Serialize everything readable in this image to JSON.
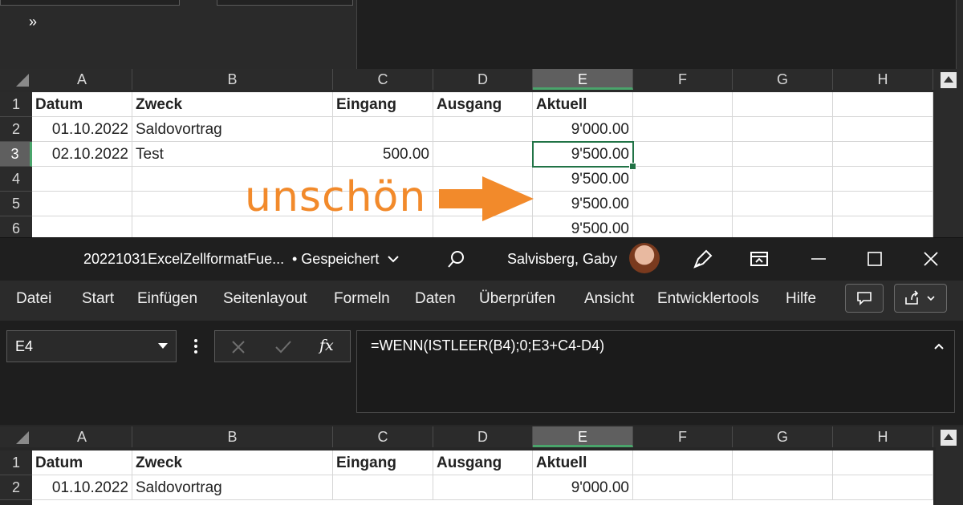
{
  "annotation": {
    "text": "unschön",
    "color": "#f28a2b"
  },
  "columns": [
    "A",
    "B",
    "C",
    "D",
    "E",
    "F",
    "G",
    "H"
  ],
  "top_sheet": {
    "rows": [
      {
        "num": "1",
        "cells": [
          "Datum",
          "Zweck",
          "Eingang",
          "Ausgang",
          "Aktuell",
          "",
          "",
          ""
        ]
      },
      {
        "num": "2",
        "cells": [
          "01.10.2022",
          "Saldovortrag",
          "",
          "",
          "9'000.00",
          "",
          "",
          ""
        ]
      },
      {
        "num": "3",
        "cells": [
          "02.10.2022",
          "Test",
          "500.00",
          "",
          "9'500.00",
          "",
          "",
          ""
        ]
      },
      {
        "num": "4",
        "cells": [
          "",
          "",
          "",
          "",
          "9'500.00",
          "",
          "",
          ""
        ]
      },
      {
        "num": "5",
        "cells": [
          "",
          "",
          "",
          "",
          "9'500.00",
          "",
          "",
          ""
        ]
      },
      {
        "num": "6",
        "cells": [
          "",
          "",
          "",
          "",
          "9'500.00",
          "",
          "",
          ""
        ]
      }
    ],
    "selected_row": "3",
    "selected_col": "E"
  },
  "titlebar": {
    "overflow_icon": "»",
    "filename": "20221031ExcelZellformatFue...",
    "status": "• Gespeichert",
    "user": "Salvisberg, Gaby",
    "icons": [
      "chevron-down-icon",
      "search-icon",
      "avatar",
      "pen-icon",
      "ribbon-display-icon",
      "minimize-icon",
      "maximize-icon",
      "close-icon"
    ]
  },
  "menu": [
    "Datei",
    "Start",
    "Einfügen",
    "Seitenlayout",
    "Formeln",
    "Daten",
    "Überprüfen",
    "Ansicht",
    "Entwicklertools",
    "Hilfe"
  ],
  "formula_bar": {
    "name_box": "E4",
    "fx_label": "fx",
    "formula": "=WENN(ISTLEER(B4);0;E3+C4-D4)"
  },
  "bottom_sheet": {
    "rows": [
      {
        "num": "1",
        "cells": [
          "Datum",
          "Zweck",
          "Eingang",
          "Ausgang",
          "Aktuell",
          "",
          "",
          ""
        ]
      },
      {
        "num": "2",
        "cells": [
          "01.10.2022",
          "Saldovortrag",
          "",
          "",
          "9'000.00",
          "",
          "",
          ""
        ]
      }
    ],
    "selected_col": "E"
  }
}
